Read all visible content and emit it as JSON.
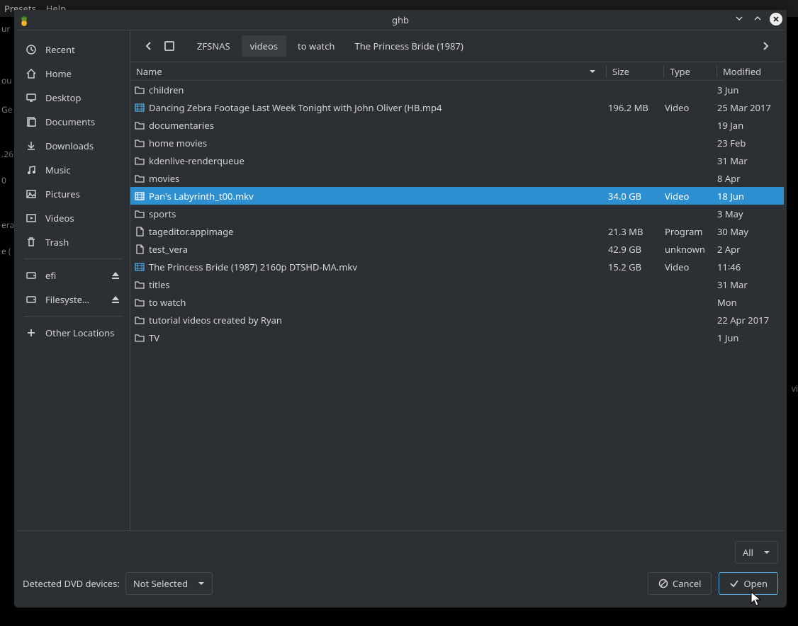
{
  "bg_menu": {
    "presets": "Presets",
    "help": "Help"
  },
  "bg_left_fragments": [
    "ur",
    "ou",
    "Ge",
    ".26",
    "0",
    "era",
    "e ("
  ],
  "bg_right_fragment": "vi",
  "window": {
    "title": "ghb"
  },
  "sidebar": {
    "places": [
      {
        "id": "recent",
        "label": "Recent",
        "icon": "clock"
      },
      {
        "id": "home",
        "label": "Home",
        "icon": "home"
      },
      {
        "id": "desktop",
        "label": "Desktop",
        "icon": "desktop"
      },
      {
        "id": "documents",
        "label": "Documents",
        "icon": "documents"
      },
      {
        "id": "downloads",
        "label": "Downloads",
        "icon": "download"
      },
      {
        "id": "music",
        "label": "Music",
        "icon": "music"
      },
      {
        "id": "pictures",
        "label": "Pictures",
        "icon": "pictures"
      },
      {
        "id": "videos",
        "label": "Videos",
        "icon": "videos"
      },
      {
        "id": "trash",
        "label": "Trash",
        "icon": "trash"
      }
    ],
    "mounts": [
      {
        "id": "efi",
        "label": "efi",
        "ejectable": true
      },
      {
        "id": "filesystem",
        "label": "Filesyste…",
        "ejectable": true
      }
    ],
    "other": {
      "label": "Other Locations"
    }
  },
  "breadcrumbs": [
    {
      "label": "ZFSNAS",
      "current": false
    },
    {
      "label": "videos",
      "current": true
    },
    {
      "label": "to watch",
      "current": false
    },
    {
      "label": "The Princess Bride (1987)",
      "current": false
    }
  ],
  "columns": {
    "name": "Name",
    "size": "Size",
    "type": "Type",
    "modified": "Modified"
  },
  "rows": [
    {
      "icon": "folder",
      "name": "children",
      "size": "",
      "type": "",
      "modified": "3 Jun",
      "selected": false
    },
    {
      "icon": "video",
      "name": "Dancing Zebra Footage Last Week Tonight with John Oliver (HB.mp4",
      "size": "196.2 MB",
      "type": "Video",
      "modified": "25 Mar 2017",
      "selected": false
    },
    {
      "icon": "folder",
      "name": "documentaries",
      "size": "",
      "type": "",
      "modified": "19 Jan",
      "selected": false
    },
    {
      "icon": "folder",
      "name": "home movies",
      "size": "",
      "type": "",
      "modified": "23 Feb",
      "selected": false
    },
    {
      "icon": "folder",
      "name": "kdenlive-renderqueue",
      "size": "",
      "type": "",
      "modified": "31 Mar",
      "selected": false
    },
    {
      "icon": "folder",
      "name": "movies",
      "size": "",
      "type": "",
      "modified": "8 Apr",
      "selected": false
    },
    {
      "icon": "video",
      "name": "Pan's Labyrinth_t00.mkv",
      "size": "34.0 GB",
      "type": "Video",
      "modified": "18 Jun",
      "selected": true
    },
    {
      "icon": "folder",
      "name": "sports",
      "size": "",
      "type": "",
      "modified": "3 May",
      "selected": false
    },
    {
      "icon": "file",
      "name": "tageditor.appimage",
      "size": "21.3 MB",
      "type": "Program",
      "modified": "30 May",
      "selected": false
    },
    {
      "icon": "file",
      "name": "test_vera",
      "size": "42.9 GB",
      "type": "unknown",
      "modified": "2 Apr",
      "selected": false
    },
    {
      "icon": "video",
      "name": "The Princess Bride (1987) 2160p DTSHD-MA.mkv",
      "size": "15.2 GB",
      "type": "Video",
      "modified": "11∶46",
      "selected": false
    },
    {
      "icon": "folder",
      "name": "titles",
      "size": "",
      "type": "",
      "modified": "31 Mar",
      "selected": false
    },
    {
      "icon": "folder",
      "name": "to watch",
      "size": "",
      "type": "",
      "modified": "Mon",
      "selected": false
    },
    {
      "icon": "folder",
      "name": "tutorial videos created by Ryan",
      "size": "",
      "type": "",
      "modified": "22 Apr 2017",
      "selected": false
    },
    {
      "icon": "folder",
      "name": "TV",
      "size": "",
      "type": "",
      "modified": "1 Jun",
      "selected": false
    }
  ],
  "filter": {
    "label": "All"
  },
  "dvd": {
    "label": "Detected DVD devices:",
    "value": "Not Selected"
  },
  "buttons": {
    "cancel": "Cancel",
    "open": "Open"
  }
}
